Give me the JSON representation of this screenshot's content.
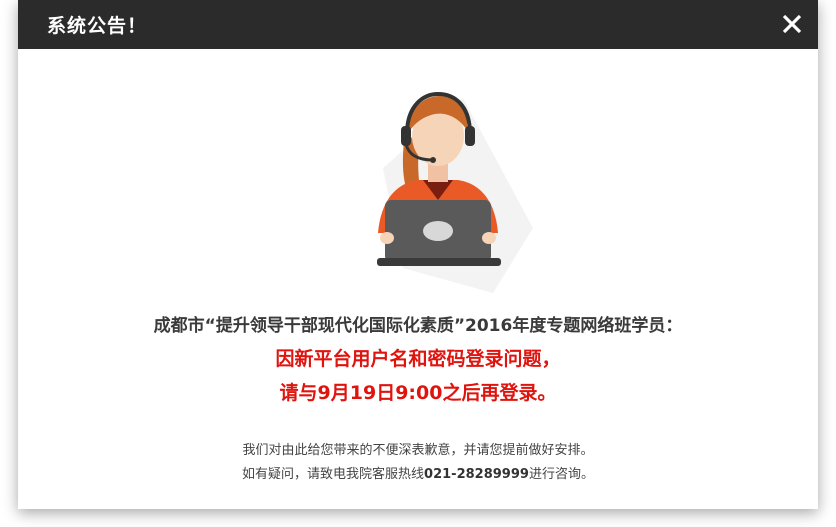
{
  "dialog": {
    "title": "系统公告！",
    "close_icon": "close-icon"
  },
  "illustration": {
    "icon": "customer-service-agent-icon",
    "colors": {
      "hair": "#c8692a",
      "skin": "#f6d4b8",
      "shirt": "#ea5a26",
      "laptop": "#5a5a5a",
      "headset": "#333333"
    }
  },
  "notice": {
    "line1": "成都市“提升领导干部现代化国际化素质”2016年度专题网络班学员：",
    "line2": "因新平台用户名和密码登录问题，",
    "line3": "请与9月19日9:00之后再登录。",
    "line4": "我们对由此给您带来的不便深表歉意，并请您提前做好安排。",
    "line5_prefix": "如有疑问，请致电我院客服热线",
    "line5_phone": "021-28289999",
    "line5_suffix": "进行咨询。"
  },
  "colors": {
    "header_bg": "#2b2b2b",
    "alert_red": "#e0140f",
    "text_dark": "#3a3a3a"
  }
}
